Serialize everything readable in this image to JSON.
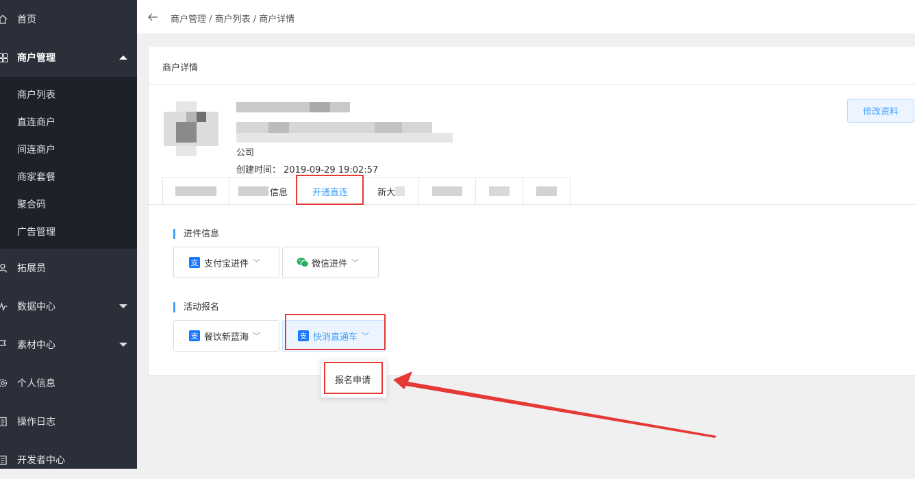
{
  "sidebar": {
    "items": [
      {
        "label": "首页",
        "icon": "home-icon"
      },
      {
        "label": "商户管理",
        "icon": "grid-icon",
        "expanded": true
      },
      {
        "label": "拓展员",
        "icon": "user-icon"
      },
      {
        "label": "数据中心",
        "icon": "chart-line-icon",
        "expanded": false
      },
      {
        "label": "素材中心",
        "icon": "flag-icon",
        "expanded": false
      },
      {
        "label": "个人信息",
        "icon": "gear-icon"
      },
      {
        "label": "操作日志",
        "icon": "clipboard-icon"
      },
      {
        "label": "开发者中心",
        "icon": "clipboard-icon"
      }
    ],
    "submenu": [
      "商户列表",
      "直连商户",
      "间连商户",
      "商家套餐",
      "聚合码",
      "广告管理"
    ]
  },
  "header": {
    "breadcrumb": "商户管理 / 商户列表 / 商户详情"
  },
  "card": {
    "title": "商户详情",
    "company": "公司",
    "created": "创建时间：  2019-09-29 19:02:57",
    "edit_button": "修改资料",
    "tabs": [
      "",
      "信息",
      "开通直连",
      "新大",
      "",
      "",
      ""
    ],
    "active_tab": "开通直连"
  },
  "sections": {
    "onboard_title": "进件信息",
    "alipay_onboard": "支付宝进件",
    "wechat_onboard": "微信进件",
    "activity_title": "活动报名",
    "catering": "餐饮新蓝海",
    "fmcg": "快消直通车",
    "alipay_glyph": "支"
  },
  "popup": {
    "item": "报名申请"
  },
  "colors": {
    "sidebar_bg": "#2b2f3a",
    "submenu_bg": "#1d2129",
    "accent": "#409eff",
    "annotation_red": "#e53935"
  }
}
